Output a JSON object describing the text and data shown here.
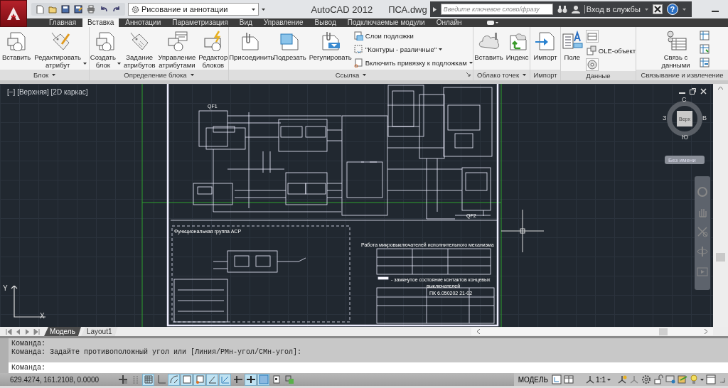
{
  "title_bar": {
    "workspace": "Рисование и аннотации",
    "app_name": "AutoCAD 2012",
    "file_name": "ПСА.dwg",
    "search": {
      "placeholder": "Введите ключевое слово/фразу"
    },
    "sign_in": "Вход в службы",
    "help": "?"
  },
  "ribbon_tabs": [
    {
      "label": "Главная",
      "selected": false
    },
    {
      "label": "Вставка",
      "selected": true
    },
    {
      "label": "Аннотации",
      "selected": false
    },
    {
      "label": "Параметризация",
      "selected": false
    },
    {
      "label": "Вид",
      "selected": false
    },
    {
      "label": "Управление",
      "selected": false
    },
    {
      "label": "Вывод",
      "selected": false
    },
    {
      "label": "Подключаемые модули",
      "selected": false
    },
    {
      "label": "Онлайн",
      "selected": false
    }
  ],
  "ribbon_panels": [
    {
      "title": "Блок",
      "menu": true,
      "large": [
        {
          "label": "Вставить",
          "dropdown": false
        },
        {
          "label": "Редактировать атрибут",
          "dropdown": true
        }
      ]
    },
    {
      "title": "Определение блока",
      "menu": true,
      "large": [
        {
          "label": "Создать блок",
          "dropdown": true
        },
        {
          "label": "Задание атрибутов",
          "dropdown": false
        },
        {
          "label": "Управление атрибутами",
          "dropdown": false
        },
        {
          "label": "Редактор блоков",
          "dropdown": false
        }
      ]
    },
    {
      "title": "Ссылка",
      "menu": true,
      "large": [
        {
          "label": "Присоединить",
          "dropdown": false
        },
        {
          "label": "Подрезать",
          "dropdown": false
        },
        {
          "label": "Регулировать",
          "dropdown": false
        }
      ],
      "small": [
        {
          "label": "Слои подложки",
          "dropdown": false
        },
        {
          "label": "\"Контуры - различные\"",
          "dropdown": true
        },
        {
          "label": "Включить привязку к подложкам",
          "dropdown": true
        }
      ]
    },
    {
      "title": "Облако точек",
      "menu": true,
      "large": [
        {
          "label": "Вставить",
          "dropdown": false
        },
        {
          "label": "Индекс",
          "dropdown": false
        }
      ]
    },
    {
      "title": "Импорт",
      "menu": false,
      "large": [
        {
          "label": "Импорт",
          "dropdown": false
        }
      ]
    },
    {
      "title": "Данные",
      "menu": false,
      "large": [
        {
          "label": "Поле",
          "dropdown": false
        }
      ],
      "small": [
        {
          "dropdown": false
        },
        {
          "label": "OLE-объект",
          "dropdown": false
        },
        {
          "dropdown": false
        }
      ]
    },
    {
      "title": "Связывание и извлечение",
      "menu": false,
      "large": [
        {
          "label": "Связь с данными",
          "dropdown": false
        }
      ],
      "small": [
        {
          "dropdown": false
        },
        {
          "dropdown": false
        },
        {
          "dropdown": false
        }
      ]
    }
  ],
  "viewport": {
    "label": "[−] [Верхняя] [2D каркас]",
    "view_cube": {
      "face": "Верх",
      "north": "С",
      "east": "В",
      "south": "Ю",
      "west": "З"
    },
    "ucs_name": "Без имени",
    "axes": {
      "x": "X",
      "y": "Y"
    },
    "drawing_texts": [
      "QF1",
      "QF2",
      "Функциональная группа АСР",
      "Работа микровыключателей исполнительного механизма",
      "- замкнутое состояние контактов концевых",
      "выключателей",
      "ПК 6.050202 21-02"
    ]
  },
  "layout_tabs": [
    {
      "label": "Модель",
      "selected": true
    },
    {
      "label": "Layout1",
      "selected": false
    }
  ],
  "command": {
    "history": [
      "Команда:",
      "Команда: Задайте противоположный угол или [Линия/РМн-угол/СМн-угол]:"
    ],
    "prompt": "Команда:"
  },
  "status_bar": {
    "coordinates": "629.4274, 161.2108, 0.0000",
    "toggles": [
      {
        "on": false
      },
      {
        "on": false
      },
      {
        "on": true
      },
      {
        "on": false
      },
      {
        "on": true
      },
      {
        "on": true
      },
      {
        "on": true
      },
      {
        "on": true
      },
      {
        "on": true
      },
      {
        "on": false
      },
      {
        "on": true
      },
      {
        "on": true
      },
      {
        "on": false
      },
      {
        "on": false
      }
    ],
    "space": "МОДЕЛЬ",
    "scale": "1:1"
  }
}
